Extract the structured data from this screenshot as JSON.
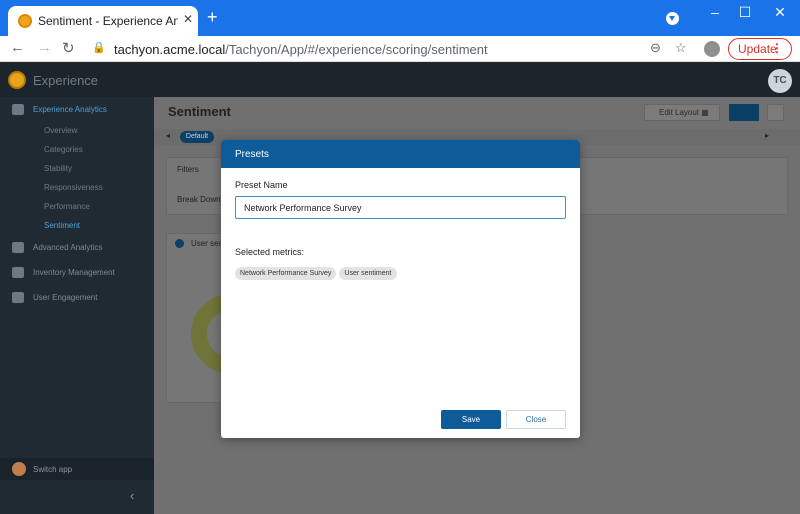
{
  "browser": {
    "tab_title": "Sentiment - Experience Analytics",
    "new_tab": "+",
    "url_host": "tachyon.acme.local",
    "url_path": "/Tachyon/App/#/experience/scoring/sentiment",
    "update_label": "Update",
    "window_controls": [
      "–",
      "☐",
      "✕"
    ]
  },
  "app": {
    "name": "Experience",
    "user_initials": "TC"
  },
  "sidebar": {
    "sections": [
      {
        "label": "Experience Analytics",
        "icon": "gauge-icon",
        "active": true
      },
      {
        "label": "Advanced Analytics",
        "icon": "binoculars-icon",
        "active": false
      },
      {
        "label": "Inventory Management",
        "icon": "monitor-icon",
        "active": false
      },
      {
        "label": "User Engagement",
        "icon": "clipboard-icon",
        "active": false
      }
    ],
    "sub_items": [
      {
        "label": "Overview"
      },
      {
        "label": "Categories"
      },
      {
        "label": "Stability"
      },
      {
        "label": "Responsiveness"
      },
      {
        "label": "Performance"
      },
      {
        "label": "Sentiment",
        "active": true
      }
    ],
    "switch_app": "Switch app"
  },
  "page": {
    "title": "Sentiment",
    "edit_layout": "Edit Layout",
    "default_preset": "Default",
    "filters_label": "Filters",
    "breakdown_label": "Break Down",
    "sentiment_card": "User sen"
  },
  "modal": {
    "title": "Presets",
    "preset_name_label": "Preset Name",
    "preset_name_value": "Network Performance Survey",
    "selected_metrics_label": "Selected metrics:",
    "metrics": [
      "Network Performance Survey",
      "User sentiment"
    ],
    "save_label": "Save",
    "close_label": "Close"
  },
  "colors": {
    "chrome_blue": "#1a73e8",
    "modal_header": "#0d5c99",
    "sidebar_bg": "#1f2a33",
    "active_link": "#4ea0d4"
  }
}
